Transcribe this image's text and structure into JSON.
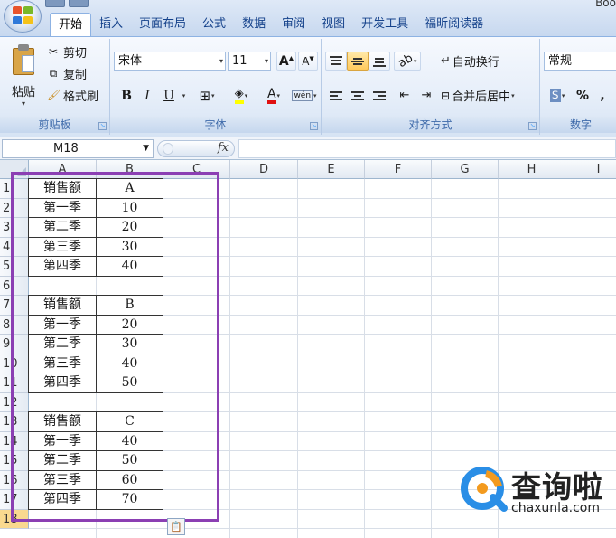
{
  "window": {
    "title_partial": "Boo"
  },
  "colors": {
    "ribbon_text": "#15428b",
    "highlight_box": "#8b3fb3",
    "selected_row_header": "#f9d98f"
  },
  "tabs": [
    "开始",
    "插入",
    "页面布局",
    "公式",
    "数据",
    "审阅",
    "视图",
    "开发工具",
    "福昕阅读器"
  ],
  "ribbon": {
    "clipboard": {
      "paste": "粘贴",
      "cut": "剪切",
      "copy": "复制",
      "format_painter": "格式刷",
      "group_label": "剪贴板"
    },
    "font": {
      "font_name": "宋体",
      "font_size": "11",
      "bold": "B",
      "italic": "I",
      "underline": "U",
      "font_color_letter": "A",
      "phonetic": "wén",
      "group_label": "字体"
    },
    "alignment": {
      "wrap_text": "自动换行",
      "merge_center": "合并后居中",
      "group_label": "对齐方式"
    },
    "number": {
      "format": "常规",
      "percent": "%",
      "comma": ",",
      "group_label": "数字"
    }
  },
  "formula_bar": {
    "name_box": "M18",
    "fx": "fx",
    "formula": ""
  },
  "columns": [
    "A",
    "B",
    "C",
    "D",
    "E",
    "F",
    "G",
    "H",
    "I"
  ],
  "rows": [
    "1",
    "2",
    "3",
    "4",
    "5",
    "6",
    "7",
    "8",
    "9",
    "10",
    "11",
    "12",
    "13",
    "14",
    "15",
    "16",
    "17",
    "18"
  ],
  "tables": [
    {
      "header_label": "销售额",
      "series": "A",
      "quarters": [
        "第一季",
        "第二季",
        "第三季",
        "第四季"
      ],
      "values": [
        "10",
        "20",
        "30",
        "40"
      ]
    },
    {
      "header_label": "销售额",
      "series": "B",
      "quarters": [
        "第一季",
        "第二季",
        "第三季",
        "第四季"
      ],
      "values": [
        "20",
        "30",
        "40",
        "50"
      ]
    },
    {
      "header_label": "销售额",
      "series": "C",
      "quarters": [
        "第一季",
        "第二季",
        "第三季",
        "第四季"
      ],
      "values": [
        "40",
        "50",
        "60",
        "70"
      ]
    }
  ],
  "watermark": {
    "text": "查询啦",
    "url": "chaxunla.com"
  }
}
